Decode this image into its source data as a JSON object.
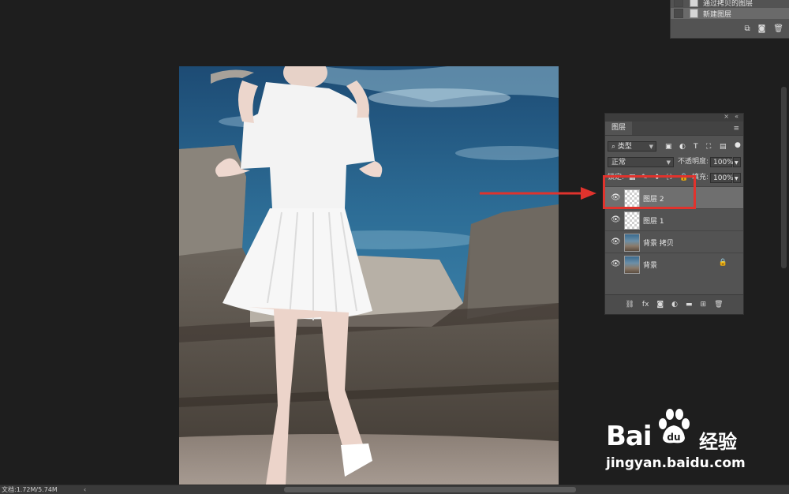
{
  "history": {
    "items": [
      {
        "label": "通过拷贝的图层"
      },
      {
        "label": "新建图层"
      }
    ]
  },
  "layers_panel": {
    "tab_label": "图层",
    "filter_kind": "类型",
    "blend_mode": "正常",
    "opacity_label": "不透明度:",
    "opacity_value": "100%",
    "lock_label": "锁定:",
    "fill_label": "填充:",
    "fill_value": "100%",
    "layers": [
      {
        "name": "图层 2",
        "selected": true
      },
      {
        "name": "图层 1",
        "selected": false
      },
      {
        "name": "背景 拷贝",
        "selected": false
      },
      {
        "name": "背景",
        "selected": false
      }
    ]
  },
  "status": {
    "doc_size": "文档:1.72M/5.74M"
  },
  "watermark": {
    "brand": "Bai",
    "brand_du": "du",
    "jingyan": "经验",
    "url": "jingyan.baidu.com"
  },
  "colors": {
    "app_bg": "#1e1e1e",
    "panel_bg": "#535353",
    "selected_layer": "#6f6f6f",
    "annotation_red": "#e0332d"
  }
}
